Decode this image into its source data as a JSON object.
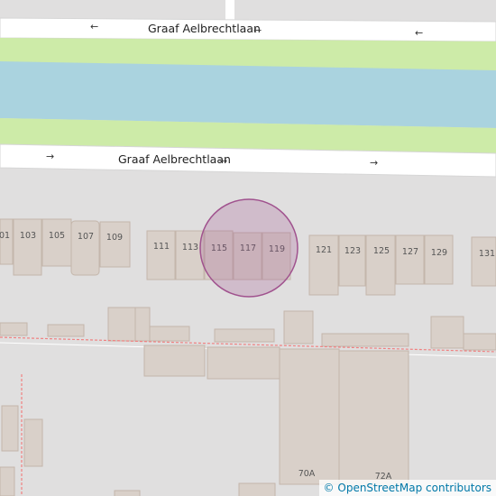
{
  "streets": [
    {
      "name": "Graaf Aelbrechtlaan",
      "arrow": "←"
    },
    {
      "name": "Graaf Aelbrechtlaan",
      "arrow": "→"
    }
  ],
  "oneway_arrows": {
    "top": "←",
    "bottom": "→"
  },
  "house_numbers": [
    "101",
    "103",
    "105",
    "107",
    "109",
    "111",
    "113",
    "115",
    "117",
    "119",
    "121",
    "123",
    "125",
    "127",
    "129",
    "131",
    "70A",
    "72A"
  ],
  "highlight": {
    "color": "#a0528e"
  },
  "colors": {
    "water": "#aad3df",
    "grass": "#cdeba8",
    "road": "#ffffff",
    "building": "#d9d0c9",
    "background": "#e0dfdf"
  },
  "attribution": {
    "symbol": "©",
    "text": "OpenStreetMap contributors"
  }
}
